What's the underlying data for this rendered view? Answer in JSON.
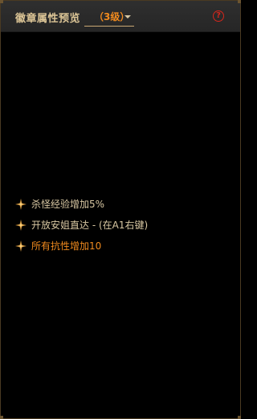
{
  "header": {
    "title": "徽章属性预览",
    "level": "（3级）"
  },
  "properties": [
    {
      "text": "杀怪经验增加5%",
      "style": "normal"
    },
    {
      "text": "开放安姐直达 - (在A1右键)",
      "style": "normal"
    },
    {
      "text": "所有抗性增加10",
      "style": "highlight"
    }
  ],
  "colors": {
    "title": "#dcc596",
    "level": "#f08a1e",
    "property_text": "#d8c7a2",
    "property_highlight": "#f08a1e",
    "help_icon": "#d4261c",
    "border": "#4a3a22"
  },
  "icons": {
    "help": "question-circle-icon",
    "dropdown": "caret-down-icon",
    "bullet": "sparkle-diamond-icon"
  }
}
